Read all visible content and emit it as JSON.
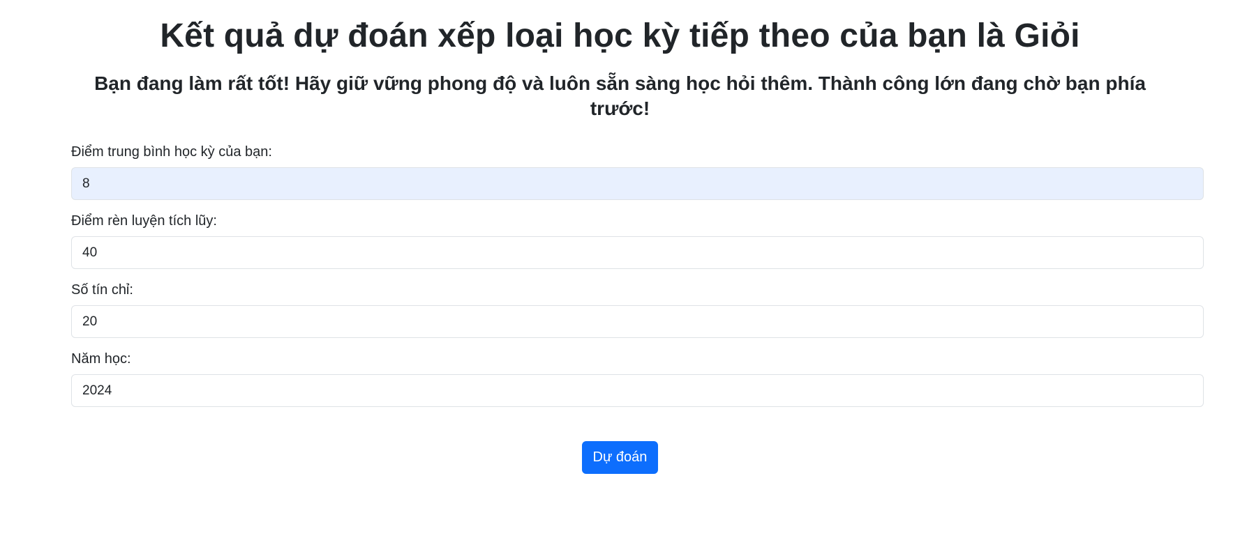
{
  "result": {
    "title": "Kết quả dự đoán xếp loại học kỳ tiếp theo của bạn là Giỏi",
    "message": "Bạn đang làm rất tốt! Hãy giữ vững phong độ và luôn sẵn sàng học hỏi thêm. Thành công lớn đang chờ bạn phía trước!"
  },
  "form": {
    "fields": [
      {
        "label": "Điểm trung bình học kỳ của bạn:",
        "value": "8"
      },
      {
        "label": "Điểm rèn luyện tích lũy:",
        "value": "40"
      },
      {
        "label": "Số tín chỉ:",
        "value": "20"
      },
      {
        "label": "Năm học:",
        "value": "2024"
      }
    ],
    "submit_label": "Dự đoán"
  },
  "colors": {
    "primary": "#0d6efd",
    "autofill_background": "#e8f0fe",
    "border": "#dee2e6",
    "text": "#212529"
  }
}
